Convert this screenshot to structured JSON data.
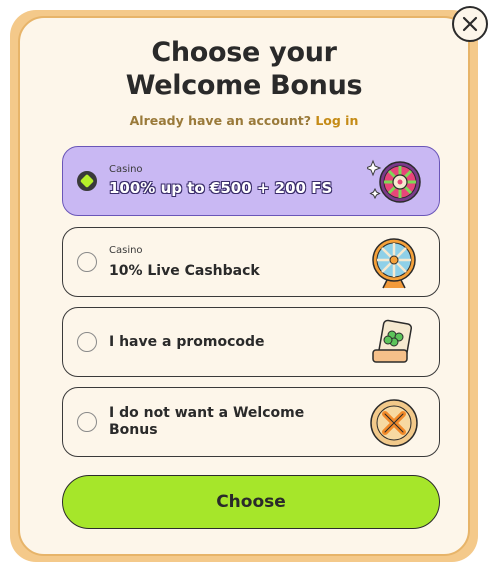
{
  "modal": {
    "title_line1": "Choose your",
    "title_line2": "Welcome Bonus",
    "account_prompt": "Already have an account?",
    "login_link": "Log in",
    "choose_label": "Choose"
  },
  "options": [
    {
      "subtitle": "Casino",
      "label": "100% up to €500 + 200 FS",
      "selected": true,
      "icon": "roulette-icon"
    },
    {
      "subtitle": "Casino",
      "label": "10% Live Cashback",
      "selected": false,
      "icon": "wheel-icon"
    },
    {
      "subtitle": "",
      "label": "I have a promocode",
      "selected": false,
      "icon": "clover-ticket-icon"
    },
    {
      "subtitle": "",
      "label_line1": "I do not want a Welcome",
      "label_line2": "Bonus",
      "selected": false,
      "icon": "cross-coin-icon"
    }
  ],
  "colors": {
    "accent_green": "#a6e62a",
    "selected_purple": "#c9b8f3",
    "frame_orange": "#f4c98a",
    "card_bg": "#fdf6ea",
    "link_gold": "#c58b16"
  }
}
